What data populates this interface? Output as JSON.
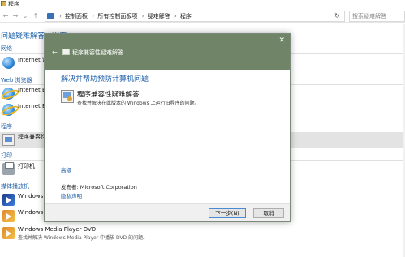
{
  "window": {
    "title": "程序"
  },
  "nav": {
    "back": "←",
    "forward": "→",
    "dropdown": "⌄",
    "up": "↑",
    "breadcrumbs": [
      "控制面板",
      "所有控制面板项",
      "疑难解答",
      "程序"
    ],
    "separator": "›",
    "refresh": "↻",
    "search_placeholder": "搜索疑难解答"
  },
  "page_title": "问题疑难解答 - 程序",
  "categories": [
    {
      "label": "网络"
    },
    {
      "label": "Web 浏览器"
    },
    {
      "label": "程序"
    },
    {
      "label": "打印"
    },
    {
      "label": "媒体播放机"
    }
  ],
  "items": [
    {
      "name": "Internet 连",
      "desc": "",
      "icon": "globe-icon"
    },
    {
      "name": "Internet Ex",
      "desc": "",
      "icon": "internet-explorer-icon"
    },
    {
      "name": "Internet Ex",
      "desc": "",
      "icon": "internet-explorer-icon"
    },
    {
      "name": "程序兼容性",
      "desc": "",
      "icon": "program-icon",
      "selected": true
    },
    {
      "name": "打印机",
      "desc": "",
      "icon": "printer-icon"
    },
    {
      "name": "Windows M",
      "desc": "",
      "icon": "media-player-icon"
    },
    {
      "name": "Windows M",
      "desc": "",
      "icon": "media-player-icon"
    },
    {
      "name": "Windows Media Player DVD",
      "desc": "查找并解决 Windows Media Player 中播放 DVD 的问题。",
      "icon": "media-player-icon"
    }
  ],
  "dialog": {
    "close": "✕",
    "back": "←",
    "title": "程序兼容性疑难解答",
    "heading": "解决并帮助预防计算机问题",
    "option_title": "程序兼容性疑难解答",
    "option_desc": "查找并解决在此版本的 Windows 上运行旧程序的问题。",
    "advanced_link": "高级",
    "publisher_label": "发布者:",
    "publisher": "Microsoft Corporation",
    "privacy_link": "隐私声明",
    "next_button": "下一步(N)",
    "cancel_button": "取消"
  },
  "colors": {
    "dialog_header": "#708468",
    "link_blue": "#1e5fa8",
    "selected_row": "#e3e3e3"
  }
}
